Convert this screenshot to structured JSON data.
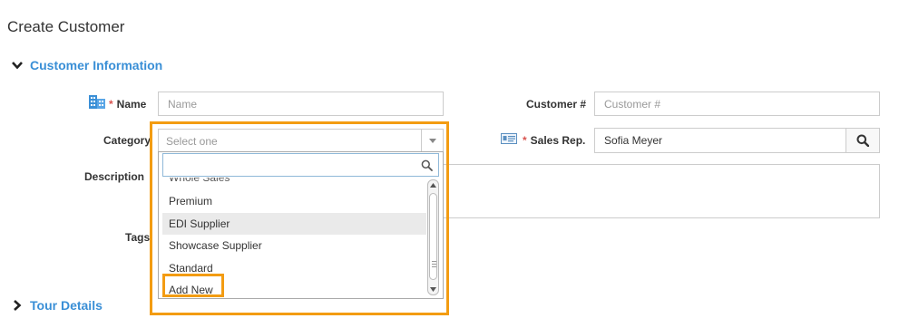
{
  "page": {
    "title": "Create Customer"
  },
  "sections": {
    "customer_info": {
      "label": "Customer Information",
      "expanded": true
    },
    "tour_details": {
      "label": "Tour Details",
      "expanded": false
    }
  },
  "form": {
    "name": {
      "label": "Name",
      "required": "*",
      "placeholder": "Name",
      "value": ""
    },
    "customer_no": {
      "label": "Customer #",
      "placeholder": "Customer #",
      "value": ""
    },
    "category": {
      "label": "Category",
      "placeholder": "Select one",
      "value": ""
    },
    "sales_rep": {
      "label": "Sales Rep.",
      "required": "*",
      "value": "Sofia Meyer"
    },
    "description": {
      "label": "Description"
    },
    "tags": {
      "label": "Tags"
    }
  },
  "category_dropdown": {
    "search_value": "",
    "options": [
      {
        "label": "Whole Sales",
        "state": "partially-hidden"
      },
      {
        "label": "Premium",
        "state": "normal"
      },
      {
        "label": "EDI Supplier",
        "state": "hover"
      },
      {
        "label": "Showcase Supplier",
        "state": "normal"
      },
      {
        "label": "Standard",
        "state": "normal"
      },
      {
        "label": "Add New",
        "state": "highlighted"
      }
    ]
  },
  "colors": {
    "accent": "#3a8fd6",
    "highlight": "#f39c12",
    "required": "#d9534f"
  },
  "icons": {
    "section_expanded": "chevron-down-icon",
    "section_collapsed": "chevron-right-icon",
    "name": "building-icon",
    "sales_rep": "id-card-icon",
    "search": "search-icon",
    "select": "caret-down-icon"
  }
}
